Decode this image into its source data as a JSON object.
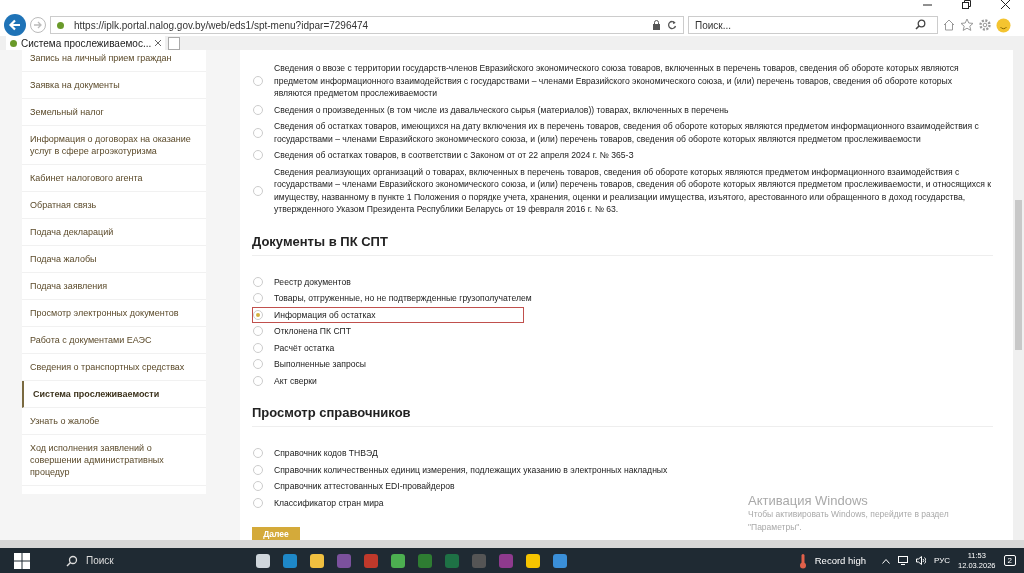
{
  "browser": {
    "url": "https://iplk.portal.nalog.gov.by/web/eds1/spt-menu?idpar=7296474",
    "search_placeholder": "Поиск...",
    "tab_title": "Система прослеживаемос..."
  },
  "sidebar": {
    "items": [
      {
        "label": "Запись на личный прием граждан",
        "selected": false
      },
      {
        "label": "Заявка на документы",
        "selected": false
      },
      {
        "label": "Земельный налог",
        "selected": false
      },
      {
        "label": "Информация о договорах на оказание услуг в сфере агроэкотуризма",
        "selected": false
      },
      {
        "label": "Кабинет налогового агента",
        "selected": false
      },
      {
        "label": "Обратная связь",
        "selected": false
      },
      {
        "label": "Подача деклараций",
        "selected": false
      },
      {
        "label": "Подача жалобы",
        "selected": false
      },
      {
        "label": "Подача заявления",
        "selected": false
      },
      {
        "label": "Просмотр электронных документов",
        "selected": false
      },
      {
        "label": "Работа с документами ЕАЭС",
        "selected": false
      },
      {
        "label": "Сведения о транспортных средствах",
        "selected": false
      },
      {
        "label": "Система прослеживаемости",
        "selected": true
      },
      {
        "label": "Узнать о жалобе",
        "selected": false
      },
      {
        "label": "Ход исполнения заявлений о совершении административных процедур",
        "selected": false
      }
    ]
  },
  "sections": [
    {
      "options": [
        {
          "label": "Сведения о ввозе с территории государств-членов Евразийского экономического союза товаров, включенных в перечень товаров, сведения об обороте которых являются предметом информационного взаимодействия с государствами – членами Евразийского экономического союза, и (или) перечень товаров, сведения об обороте которых являются предметом прослеживаемости",
          "selected": false
        },
        {
          "label": "Сведения о произведенных (в том числе из давальческого сырья (материалов)) товарах, включенных в перечень",
          "selected": false
        },
        {
          "label": "Сведения об остатках товаров, имеющихся на дату включения их в перечень товаров, сведения об обороте которых являются предметом информационного взаимодействия с государствами – членами Евразийского экономического союза, и (или) перечень товаров, сведения об обороте которых являются предметом прослеживаемости",
          "selected": false
        },
        {
          "label": "Сведения об остатках товаров, в соответствии с Законом от от 22 апреля 2024 г. № 365-З",
          "selected": false
        },
        {
          "label": "Сведения реализующих организаций о товарах, включенных в перечень товаров, сведения об обороте которых являются предметом информационного взаимодействия с государствами – членами Евразийского экономического союза, и (или) перечень товаров, сведения об обороте которых являются предметом прослеживаемости, и относящихся к имуществу, названному в пункте 1 Положения о порядке учета, хранения, оценки и реализации имущества, изъятого, арестованного или обращенного в доход государства, утвержденного Указом Президента Республики Беларусь от 19 февраля 2016 г. № 63.",
          "selected": false
        }
      ]
    },
    {
      "title": "Документы в ПК СПТ",
      "options": [
        {
          "label": "Реестр документов",
          "selected": false
        },
        {
          "label": "Товары, отгруженные, но не подтвержденные грузополучателем",
          "selected": false
        },
        {
          "label": "Информация об остатках",
          "selected": true
        },
        {
          "label": "Отклонена ПК СПТ",
          "selected": false
        },
        {
          "label": "Расчёт остатка",
          "selected": false
        },
        {
          "label": "Выполненные запросы",
          "selected": false
        },
        {
          "label": "Акт сверки",
          "selected": false
        }
      ]
    },
    {
      "title": "Просмотр справочников",
      "options": [
        {
          "label": "Справочник кодов ТНВЭД",
          "selected": false
        },
        {
          "label": "Справочник количественных единиц измерения, подлежащих указанию в электронных накладных",
          "selected": false
        },
        {
          "label": "Справочник аттестованных EDI-провайдеров",
          "selected": false
        },
        {
          "label": "Классификатор стран мира",
          "selected": false
        }
      ]
    }
  ],
  "next_button": "Далее",
  "activation": {
    "title": "Активация Windows",
    "text": "Чтобы активировать Windows, перейдите в раздел \"Параметры\"."
  },
  "taskbar": {
    "search": "Поиск",
    "weather": "Record high",
    "language": "РУС",
    "time": "11:53",
    "date": "12.03.2026",
    "notifications": "2"
  }
}
